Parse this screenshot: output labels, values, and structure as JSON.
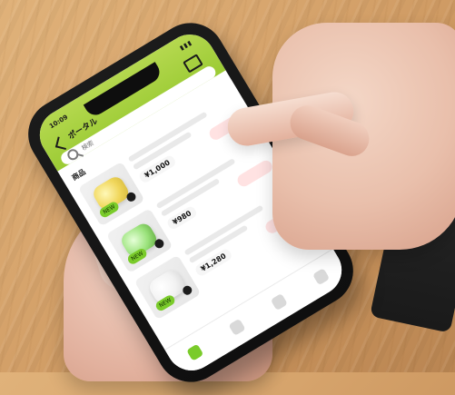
{
  "status_bar": {
    "time": "10:09",
    "icons": "▮▮▮"
  },
  "app": {
    "title": "ポータル",
    "search_placeholder": "検索"
  },
  "sections": [
    {
      "label": "商品",
      "items": [
        {
          "tag": "NEW",
          "price": "¥1,000",
          "blob": "yellow"
        },
        {
          "tag": "NEW",
          "price": "¥980",
          "blob": "green"
        },
        {
          "tag": "NEW",
          "price": "¥1,280",
          "blob": "white"
        }
      ]
    }
  ],
  "colors": {
    "accent": "#9bcb34",
    "accent_dark": "#7acb2a",
    "price_pill": "#ffe2e2"
  },
  "icons": [
    "back-icon",
    "cart-icon",
    "search-icon",
    "heart-icon",
    "home-icon",
    "search-nav-icon",
    "favorite-icon",
    "profile-icon"
  ]
}
